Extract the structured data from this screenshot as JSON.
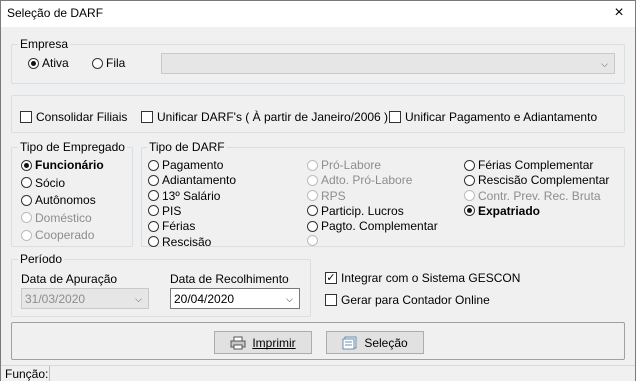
{
  "window": {
    "title": "Seleção de DARF",
    "close_icon": "×"
  },
  "empresa": {
    "title": "Empresa",
    "ativa_label": "Ativa",
    "fila_label": "Fila",
    "selected": "Ativa",
    "combo_value": ""
  },
  "options": {
    "consolidar": "Consolidar Filiais",
    "unificar_darf": "Unificar DARF's ( À partir de Janeiro/2006 )",
    "unificar_pagamento": "Unificar Pagamento e Adiantamento"
  },
  "tipo_empregado": {
    "title": "Tipo de Empregado",
    "items": [
      "Funcionário",
      "Sócio",
      "Autônomos",
      "Doméstico",
      "Cooperado"
    ],
    "selected": "Funcionário"
  },
  "tipo_darf": {
    "title": "Tipo de DARF",
    "col1": [
      "Pagamento",
      "Adiantamento",
      "13º Salário",
      "PIS",
      "Férias",
      "Rescisão"
    ],
    "col2": [
      "Pró-Labore",
      "Adto. Pró-Labore",
      "RPS",
      "Particip. Lucros",
      "Pagto. Complementar",
      ""
    ],
    "col3": [
      "Férias Complementar",
      "Rescisão Complementar",
      "Contr. Prev. Rec. Bruta",
      "Expatriado"
    ],
    "selected": "Expatriado"
  },
  "periodo": {
    "title": "Período",
    "apuracao_label": "Data de Apuração",
    "apuracao_value": "31/03/2020",
    "recolhimento_label": "Data de Recolhimento",
    "recolhimento_value": "20/04/2020"
  },
  "checks": {
    "gescon_label": "Integrar com o Sistema GESCON",
    "gescon_checked": true,
    "contador_label": "Gerar para Contador Online",
    "contador_checked": false
  },
  "buttons": {
    "imprimir": "Imprimir",
    "selecao": "Seleção"
  },
  "status": {
    "funcao_label": "Função:"
  }
}
